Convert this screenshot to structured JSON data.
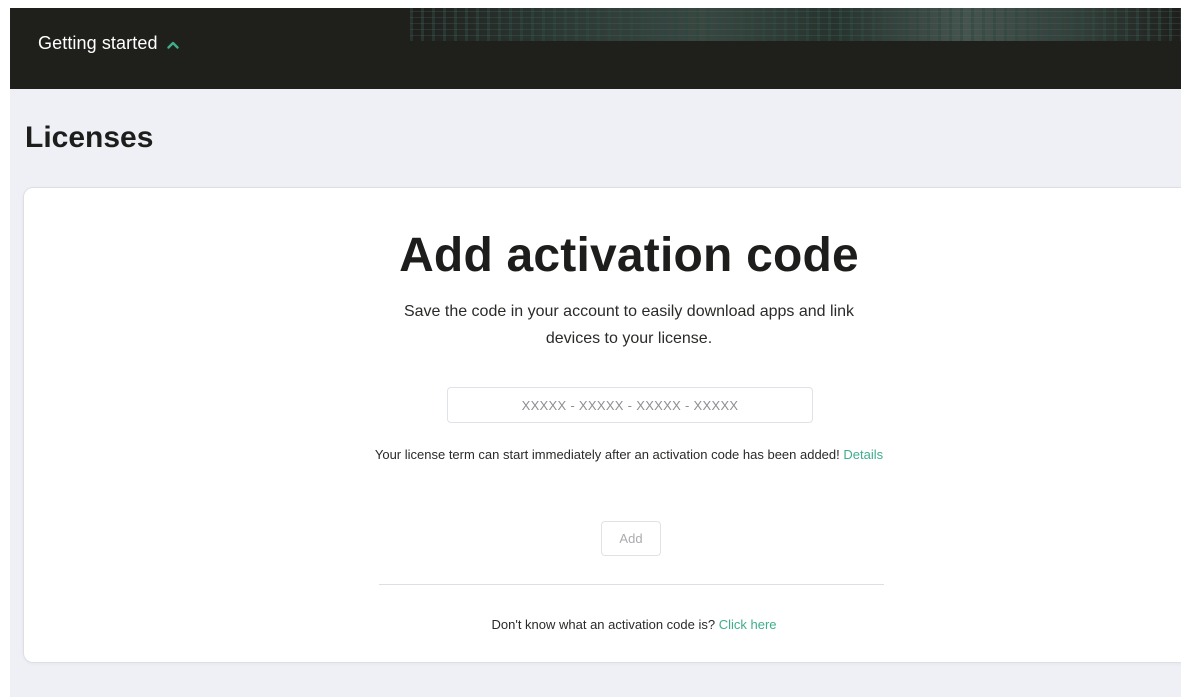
{
  "header": {
    "getting_started_label": "Getting started"
  },
  "page": {
    "title": "Licenses"
  },
  "activation": {
    "title": "Add activation code",
    "description": "Save the code in your account to easily download apps and link devices to your license.",
    "input_placeholder": "XXXXX - XXXXX - XXXXX - XXXXX",
    "input_value": "",
    "term_note": "Your license term can start immediately after an activation code has been added!",
    "details_link": "Details",
    "add_button": "Add",
    "help_question": "Don't know what an activation code is?",
    "help_link": "Click here"
  },
  "colors": {
    "accent": "#3fad8c",
    "header_bg": "#1f1f1c",
    "page_bg": "#eef0f6",
    "text": "#1d1d1b"
  },
  "icons": {
    "getting_started_toggle": "chevron-up-icon"
  }
}
